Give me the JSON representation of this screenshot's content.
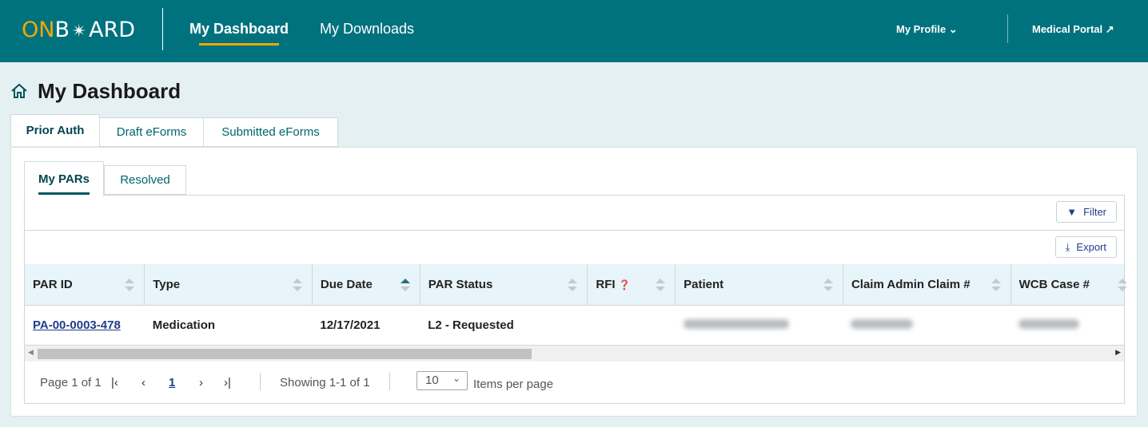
{
  "header": {
    "logo": "ONBOARD",
    "logo_on": "ON",
    "logo_b": "B",
    "logo_rest": "ARD",
    "nav": [
      {
        "label": "My Dashboard",
        "active": true
      },
      {
        "label": "My Downloads"
      }
    ],
    "profile": "My Profile",
    "portal": "Medical Portal",
    "accent": "#f5a800",
    "bg": "#00727e"
  },
  "page": {
    "title": "My Dashboard"
  },
  "tabs": [
    "Prior Auth",
    "Draft eForms",
    "Submitted eForms"
  ],
  "subtabs": [
    "My PARs",
    "Resolved"
  ],
  "toolbar": {
    "filter": "Filter",
    "export": "Export"
  },
  "table": {
    "columns": [
      "PAR ID",
      "Type",
      "Due Date",
      "PAR Status",
      "RFI",
      "Patient",
      "Claim Admin Claim #",
      "WCB Case #"
    ],
    "sorted_column": "Due Date",
    "sort_direction": "ascending",
    "rows": [
      {
        "par_id": "PA-00-0003-478",
        "type": "Medication",
        "due_date": "12/17/2021",
        "status": "L2 - Requested",
        "rfi": "",
        "patient": "[redacted]",
        "claim": "[redacted]",
        "wcb": "[redacted]"
      }
    ]
  },
  "pagination": {
    "page_info": "Page 1 of 1",
    "current": "1",
    "showing": "Showing 1-1 of 1",
    "per_page": "10",
    "per_page_label": "Items per page"
  }
}
